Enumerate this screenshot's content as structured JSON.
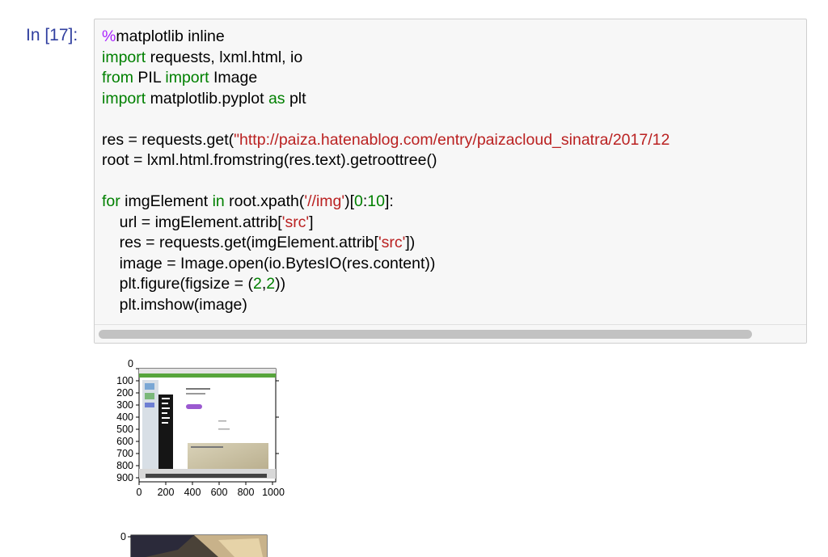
{
  "cell": {
    "prompt": "In [17]:",
    "lines": [
      "%matplotlib inline",
      "import requests, lxml.html, io",
      "from PIL import Image",
      "import matplotlib.pyplot as plt",
      "",
      "res = requests.get(\"http://paiza.hatenablog.com/entry/paizacloud_sinatra/2017/12",
      "root = lxml.html.fromstring(res.text).getroottree()",
      "",
      "for imgElement in root.xpath('//img')[0:10]:",
      "    url = imgElement.attrib['src']",
      "    res = requests.get(imgElement.attrib['src'])",
      "    image = Image.open(io.BytesIO(res.content))",
      "    plt.figure(figsize = (2,2))",
      "    plt.imshow(image)"
    ]
  },
  "plot1": {
    "y_ticks": [
      "0",
      "100",
      "200",
      "300",
      "400",
      "500",
      "600",
      "700",
      "800",
      "900"
    ],
    "x_ticks": [
      "0",
      "200",
      "400",
      "600",
      "800",
      "1000"
    ]
  },
  "plot2": {
    "y_ticks": [
      "0"
    ]
  },
  "colors": {
    "keyword": "#008000",
    "magic": "#aa22ff",
    "string": "#ba2121",
    "prompt": "#303f9f"
  }
}
